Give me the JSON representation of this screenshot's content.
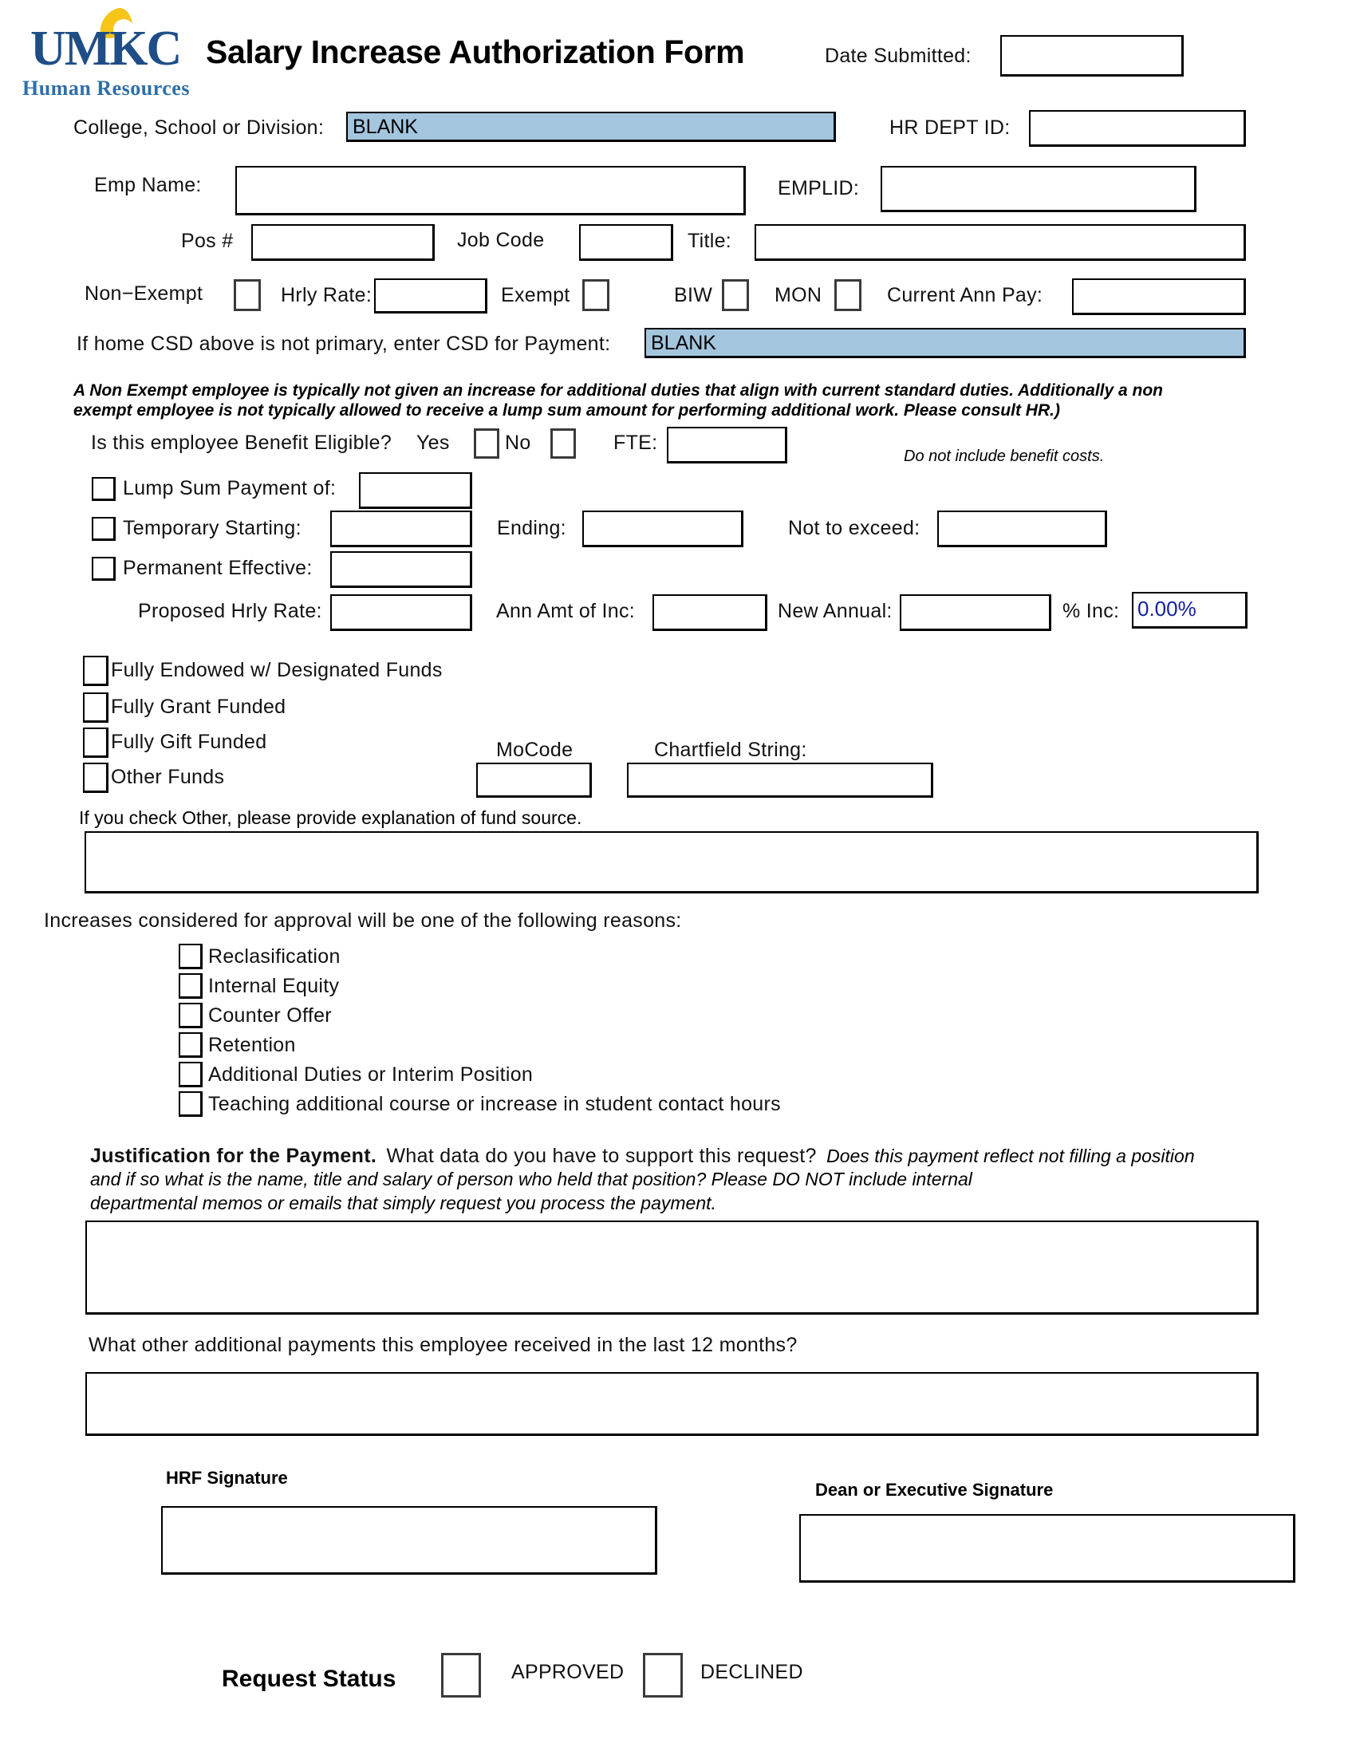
{
  "header": {
    "logo_word": "UMKC",
    "logo_sub": "Human Resources",
    "title": "Salary Increase Authorization Form",
    "date_submitted_label": "Date Submitted:",
    "date_submitted_value": ""
  },
  "identity": {
    "csd_label": "College, School or Division:",
    "csd_value": "BLANK",
    "hr_dept_id_label": "HR DEPT ID:",
    "hr_dept_id_value": "",
    "emp_name_label": "Emp Name:",
    "emp_name_value": "",
    "emplid_label": "EMPLID:",
    "emplid_value": "",
    "pos_label": "Pos #",
    "pos_value": "",
    "job_code_label": "Job Code",
    "job_code_value": "",
    "title_label": "Title:",
    "title_value": ""
  },
  "classification": {
    "non_exempt_label": "Non−Exempt",
    "hrly_rate_label": "Hrly Rate:",
    "hrly_rate_value": "",
    "exempt_label": "Exempt",
    "biw_label": "BIW",
    "mon_label": "MON",
    "current_ann_pay_label": "Current  Ann Pay:",
    "current_ann_pay_value": ""
  },
  "csd_payment": {
    "label": "If home CSD above is not primary, enter CSD for Payment:",
    "value": "BLANK"
  },
  "notes": {
    "non_exempt_note_line1": "A Non Exempt  employee is typically not given an increase for additional duties that align with current standard duties.  Additionally a non",
    "non_exempt_note_line2": "exempt employee is not typically allowed to receive a lump sum amount for performing additional work. Please consult HR.)",
    "benefit_costs_note": "Do not include benefit costs."
  },
  "benefit": {
    "question": "Is this employee Benefit Eligible?",
    "yes_label": "Yes",
    "no_label": "No",
    "fte_label": "FTE:",
    "fte_value": ""
  },
  "payment_options": {
    "lump_sum_label": "Lump Sum Payment of:",
    "lump_sum_value": "",
    "temporary_starting_label": "Temporary Starting:",
    "temporary_starting_value": "",
    "ending_label": "Ending:",
    "ending_value": "",
    "not_to_exceed_label": "Not to exceed:",
    "not_to_exceed_value": "",
    "permanent_effective_label": "Permanent Effective:",
    "permanent_effective_value": ""
  },
  "amounts": {
    "proposed_hrly_rate_label": "Proposed Hrly Rate:",
    "proposed_hrly_rate_value": "",
    "ann_amt_of_inc_label": "Ann Amt of Inc:",
    "ann_amt_of_inc_value": "",
    "new_annual_label": "New Annual:",
    "new_annual_value": "",
    "pct_inc_label": "% Inc:",
    "pct_inc_value": "0.00%",
    "pct_inc_color": "#12219b"
  },
  "funding": {
    "options": [
      "Fully Endowed w/ Designated Funds",
      "Fully Grant Funded",
      "Fully Gift Funded",
      "Other Funds"
    ],
    "mocode_label": "MoCode",
    "mocode_value": "",
    "chartfield_label": "Chartfield String:",
    "chartfield_value": "",
    "other_explanation_label": "If you check Other, please provide explanation of fund source.",
    "other_explanation_value": ""
  },
  "reasons": {
    "heading": "Increases considered for approval will be one of the following reasons:",
    "items": [
      "Reclasification",
      "Internal Equity",
      "Counter Offer",
      "Retention",
      "Additional Duties or Interim Position",
      "Teaching additional course or increase in student contact hours"
    ]
  },
  "justification": {
    "bold_lead": "Justification for the Payment.",
    "question": "What data do you have to support this request?",
    "italic_line1": "Does this payment reflect not filling a position",
    "italic_line2": "and if so what is the name, title and salary of person who held that position? Please DO NOT include internal",
    "italic_line3": "departmental memos or emails that simply request you process the payment.",
    "value": "",
    "other_payments_label": "What other additional payments this employee received in the last 12 months?",
    "other_payments_value": ""
  },
  "signatures": {
    "hrf_label": "HRF Signature",
    "hrf_value": "",
    "dean_label": "Dean or Executive Signature",
    "dean_value": ""
  },
  "status": {
    "label": "Request Status",
    "approved_label": "APPROVED",
    "declined_label": "DECLINED"
  },
  "colors": {
    "highlight": "#a3c6de",
    "logo_blue": "#1f4e87",
    "value_blue": "#12219b"
  }
}
